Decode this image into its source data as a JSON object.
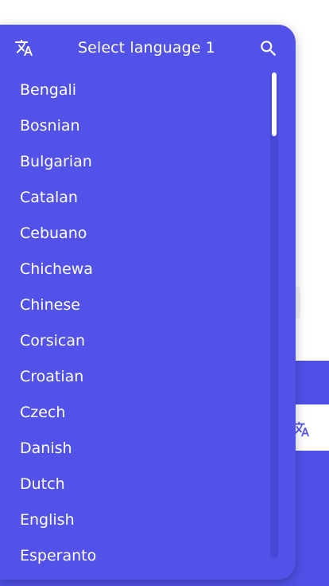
{
  "colors": {
    "panel_bg": "#5252e8",
    "accent": "#5050e6",
    "text": "#ffffff"
  },
  "dropdown": {
    "title": "Select language 1",
    "header_icon": "translate-icon",
    "search_icon": "search-icon",
    "languages": [
      "Bengali",
      "Bosnian",
      "Bulgarian",
      "Catalan",
      "Cebuano",
      "Chichewa",
      "Chinese",
      "Corsican",
      "Croatian",
      "Czech",
      "Danish",
      "Dutch",
      "English",
      "Esperanto"
    ]
  },
  "background": {
    "translate_icon": "translate-icon"
  }
}
